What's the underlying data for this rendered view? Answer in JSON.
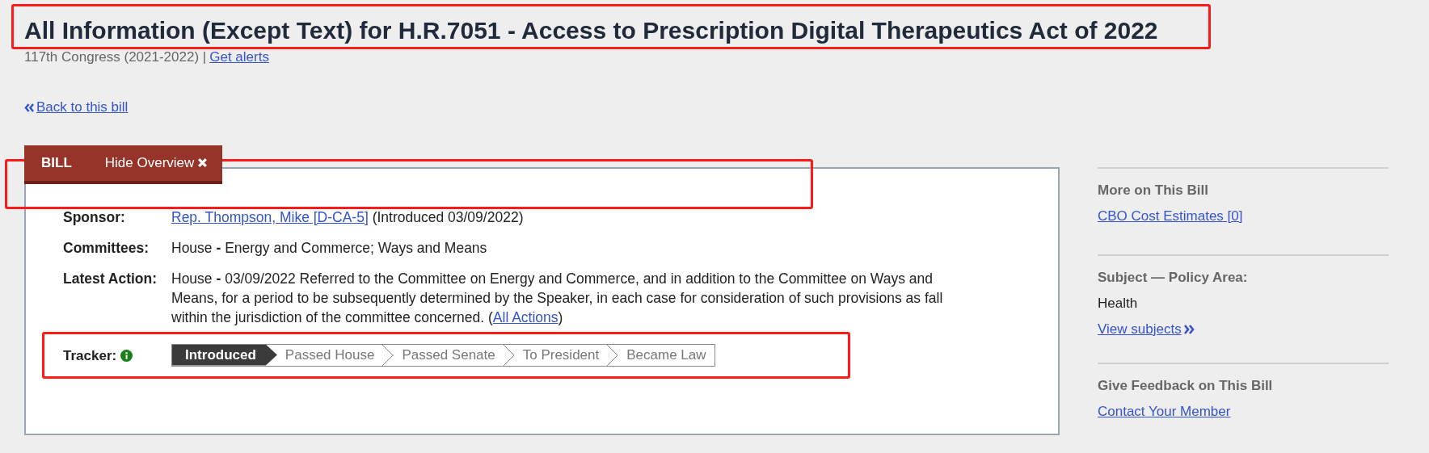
{
  "title": {
    "text": "All Information (Except Text) for H.R.7051 - Access to Prescription Digital Therapeutics Act of 2022",
    "highlighted": true
  },
  "subtitle": {
    "congress": "117th Congress (2021-2022) |",
    "link": "Get alerts"
  },
  "back_link": "Back to this bill",
  "tabs": [
    {
      "label": "BILL",
      "kind": "label"
    },
    {
      "label": "Hide Overview",
      "kind": "toggle"
    }
  ],
  "overview": [
    {
      "label": "Sponsor:",
      "link": "Rep. Thompson, Mike [D-CA-5]",
      "text": " (Introduced 03/09/2022)"
    },
    {
      "label": "Committees:",
      "text": "House **-** Energy and Commerce; Ways and Means"
    },
    {
      "label": "Latest Action:",
      "text": "House **-** 03/09/2022 Referred to the Committee on Energy and Commerce, and in addition to the Committee on Ways and Means, for a period to be subsequently determined by the Speaker, in each case for consideration of such provisions as fall within the jurisdiction of the committee concerned.  (",
      "link": "All Actions",
      "after": ")"
    }
  ],
  "tracker": {
    "label": "Tracker:",
    "highlighted": true,
    "steps": [
      {
        "label": "Introduced",
        "selected": true
      },
      {
        "label": "Passed House",
        "selected": false
      },
      {
        "label": "Passed Senate",
        "selected": false
      },
      {
        "label": "To President",
        "selected": false
      },
      {
        "label": "Became Law",
        "selected": false
      }
    ]
  },
  "sidebar": [
    {
      "heading": "More on This Bill",
      "items": [
        {
          "kind": "link",
          "text": "CBO Cost Estimates [0]"
        }
      ]
    },
    {
      "heading": "Subject — Policy Area:",
      "items": [
        {
          "kind": "text",
          "text": "Health"
        },
        {
          "kind": "more-link",
          "text": "View subjects"
        }
      ]
    },
    {
      "heading": "Give Feedback on This Bill",
      "items": [
        {
          "kind": "link",
          "text": "Contact Your Member"
        }
      ]
    }
  ]
}
